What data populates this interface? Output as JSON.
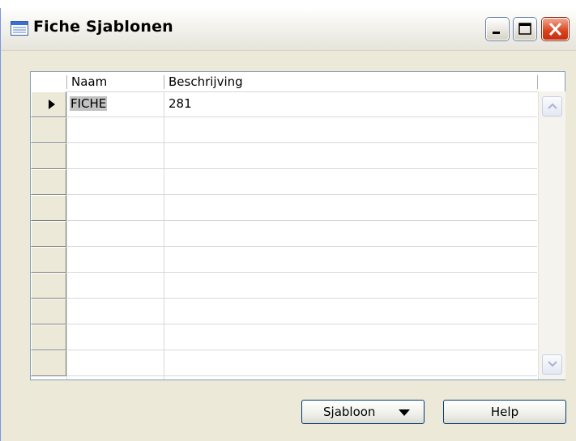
{
  "window": {
    "title": "Fiche Sjablonen",
    "title_icon": "form-icon",
    "controls": [
      "minimize-icon",
      "maximize-icon",
      "close-icon"
    ]
  },
  "table": {
    "columns": [
      "Naam",
      "Beschrijving"
    ],
    "rows": [
      {
        "naam": "FICHE",
        "beschrijving": "281",
        "selected": true
      }
    ],
    "empty_rows": 10
  },
  "buttons": {
    "sjabloon_label": "Sjabloon",
    "sjabloon_icon": "dropdown-arrow-icon",
    "help_label": "Help"
  },
  "colors": {
    "window_bg": "#ece9d8",
    "close_button": "#d9421b",
    "cell_highlight": "#c3c3c3"
  }
}
